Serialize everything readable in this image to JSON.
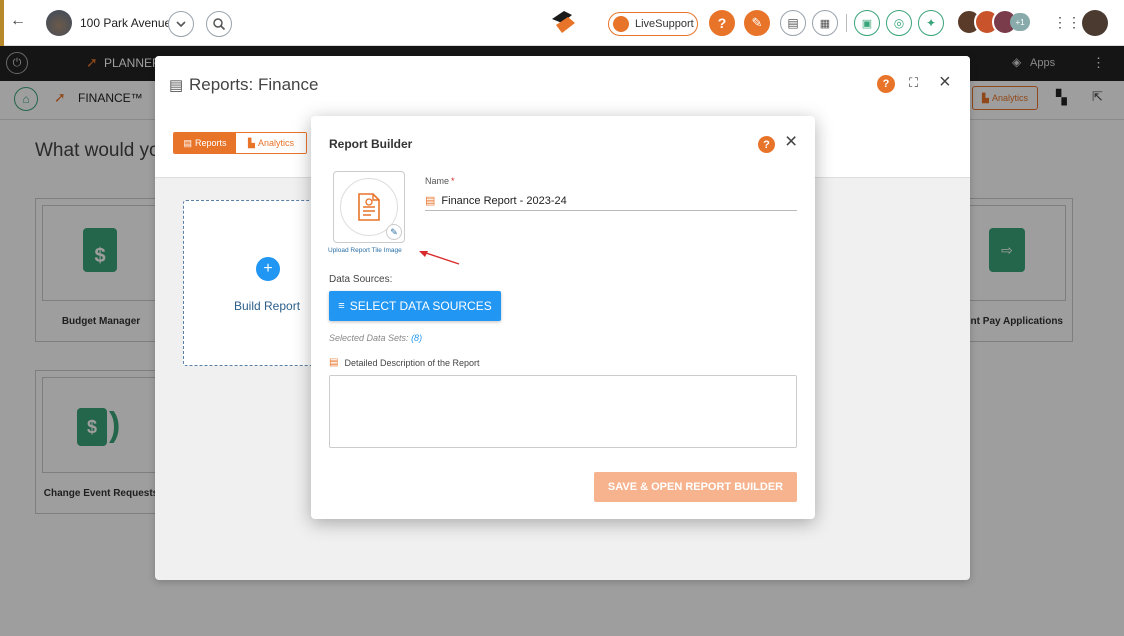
{
  "topbar": {
    "location": "100 Park Avenue",
    "live_support": "LiveSupport",
    "avatar_badge": "+1"
  },
  "darkbar": {
    "planner_label": "PLANNER",
    "apps_label": "Apps"
  },
  "subbar": {
    "module_label": "FINANCE™",
    "analytics_label": "Analytics"
  },
  "background": {
    "prompt": "What would yo",
    "tiles": [
      {
        "label": "Budget Manager"
      },
      {
        "label": "Change Event Requests"
      },
      {
        "label": "ent Pay Applications"
      }
    ]
  },
  "panel": {
    "title": "Reports: Finance",
    "tabs": [
      "Reports",
      "Analytics"
    ],
    "build_report": "Build Report"
  },
  "modal": {
    "title": "Report Builder",
    "upload_label": "Upload Report Tile Image",
    "name_label": "Name",
    "required_mark": "*",
    "name_value": "Finance Report - 2023-24",
    "data_sources_label": "Data Sources:",
    "select_button": "SELECT DATA SOURCES",
    "selected_prefix": "Selected Data Sets:",
    "selected_count": "(8)",
    "description_label": "Detailed Description of the Report",
    "description_value": "",
    "save_button": "SAVE & OPEN REPORT BUILDER"
  },
  "colors": {
    "accent_orange": "#e8742a",
    "primary_blue": "#2196f3",
    "save_disabled": "#f6b38e",
    "green": "#3aa57a"
  },
  "icons": [
    "back-arrow-icon",
    "chevron-down-icon",
    "search-icon",
    "brand-logo-icon",
    "help-icon",
    "hammer-icon",
    "clipboard-icon",
    "grid-icon",
    "close-icon",
    "maximize-icon",
    "database-icon",
    "document-icon",
    "home-icon",
    "external-link-icon",
    "pencil-icon",
    "plus-icon",
    "more-vert-icon"
  ]
}
